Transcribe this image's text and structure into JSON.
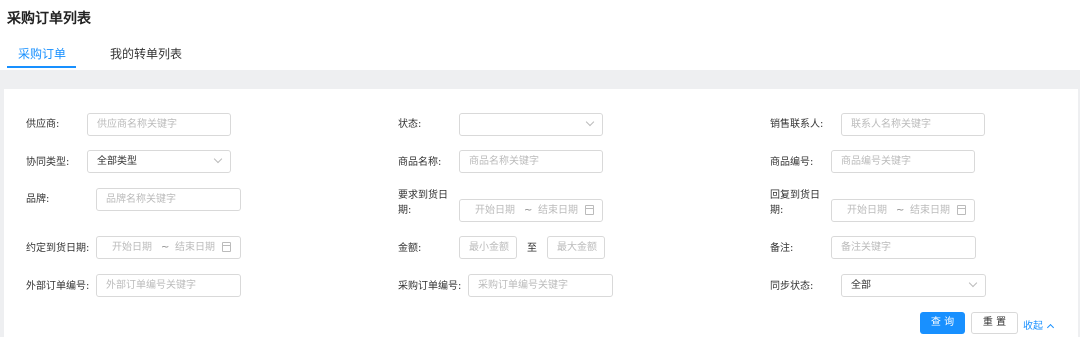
{
  "page": {
    "title": "采购订单列表"
  },
  "tabs": [
    {
      "label": "采购订单",
      "active": true
    },
    {
      "label": "我的转单列表",
      "active": false
    }
  ],
  "colors": {
    "accent": "#1890ff",
    "border": "#d9d9d9",
    "placeholder": "#bbbbbb",
    "background_bar": "#eeeff1"
  },
  "filters": {
    "supplier": {
      "label": "供应商:",
      "placeholder": "供应商名称关键字"
    },
    "status": {
      "label": "状态:",
      "value": ""
    },
    "sales_contact": {
      "label": "销售联系人:",
      "placeholder": "联系人名称关键字"
    },
    "collab_type": {
      "label": "协同类型:",
      "value": "全部类型"
    },
    "product_name": {
      "label": "商品名称:",
      "placeholder": "商品名称关键字"
    },
    "product_code": {
      "label": "商品编号:",
      "placeholder": "商品编号关键字"
    },
    "brand": {
      "label": "品牌:",
      "placeholder": "品牌名称关键字"
    },
    "required_date": {
      "label_line1": "要求到货日",
      "label_line2": "期:",
      "start": "开始日期",
      "tilde": "~",
      "end": "结束日期"
    },
    "reply_date": {
      "label_line1": "回复到货日",
      "label_line2": "期:",
      "start": "开始日期",
      "tilde": "~",
      "end": "结束日期"
    },
    "agreed_date": {
      "label": "约定到货日期:",
      "start": "开始日期",
      "tilde": "~",
      "end": "结束日期"
    },
    "amount": {
      "label": "金额:",
      "min_placeholder": "最小金额",
      "to": "至",
      "max_placeholder": "最大金额"
    },
    "remark": {
      "label": "备注:",
      "placeholder": "备注关键字"
    },
    "external_no": {
      "label": "外部订单编号:",
      "placeholder": "外部订单编号关键字"
    },
    "po_no": {
      "label": "采购订单编号:",
      "placeholder": "采购订单编号关键字"
    },
    "sync_status": {
      "label": "同步状态:",
      "value": "全部"
    }
  },
  "actions": {
    "query": "查 询",
    "reset": "重 置",
    "collapse": "收起"
  }
}
